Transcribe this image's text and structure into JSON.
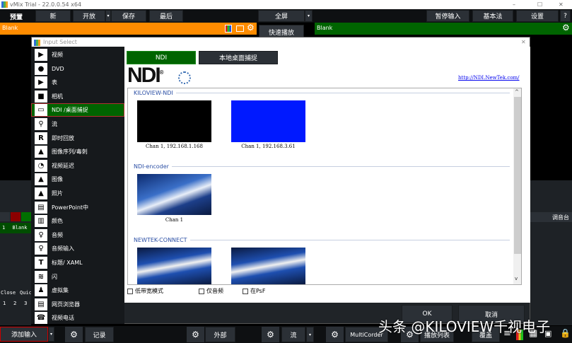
{
  "window": {
    "title": "vMix Trial - 22.0.0.54 x64",
    "min": "–",
    "max": "☐",
    "close": "✕"
  },
  "toolbar": {
    "preset": "预置",
    "new": "新",
    "open": "开放",
    "save": "保存",
    "last": "最后",
    "fullscreen": "全屏",
    "pause_input": "暂停输入",
    "basic": "基本法",
    "settings": "设置",
    "help": "?",
    "dropdown": "▾"
  },
  "preview": {
    "label": "Blank"
  },
  "output": {
    "label": "Blank"
  },
  "quick_play": "快速播放",
  "left_panel": {
    "input_number": "1",
    "input_name": "Blank",
    "close": "Close",
    "quick": "Quic",
    "nums": [
      "1",
      "2",
      "3"
    ]
  },
  "right_panel": {
    "mixer": "调音台"
  },
  "dialog": {
    "title": "Input Select",
    "close": "✕",
    "categories": [
      {
        "label": "视频",
        "icon": "▶"
      },
      {
        "label": "DVD",
        "icon": "●"
      },
      {
        "label": "表",
        "icon": "▶"
      },
      {
        "label": "相机",
        "icon": "■"
      },
      {
        "label": "NDI /桌面捕捉",
        "icon": "▭"
      },
      {
        "label": "流",
        "icon": "⚲"
      },
      {
        "label": "即时回放",
        "icon": "R"
      },
      {
        "label": "图像序列/毒刺",
        "icon": "▲"
      },
      {
        "label": "视频延迟",
        "icon": "◔"
      },
      {
        "label": "图像",
        "icon": "▲"
      },
      {
        "label": "照片",
        "icon": "▲"
      },
      {
        "label": "PowerPoint中",
        "icon": "▤"
      },
      {
        "label": "颜色",
        "icon": "▥"
      },
      {
        "label": "音频",
        "icon": "♀"
      },
      {
        "label": "音频输入",
        "icon": "♀"
      },
      {
        "label": "标题/ XAML",
        "icon": "T"
      },
      {
        "label": "闪",
        "icon": "≋"
      },
      {
        "label": "虚拟集",
        "icon": "♟"
      },
      {
        "label": "网页浏览器",
        "icon": "▤"
      },
      {
        "label": "视频电话",
        "icon": "☎"
      }
    ],
    "selected_index": 4,
    "tabs": [
      "NDI",
      "本地桌面捕捉"
    ],
    "logo": "NDI",
    "link": "http://NDI.NewTek.com/",
    "sections": [
      {
        "name": "KILOVIEW-NDI",
        "sources": [
          {
            "label": "Chan 1, 192.168.1.168",
            "color": "#000000"
          },
          {
            "label": "Chan 1, 192.168.3.61",
            "color": "#0019ff"
          }
        ]
      },
      {
        "name": "NDI-encoder",
        "sources": [
          {
            "label": "Chan 1"
          }
        ]
      },
      {
        "name": "NEWTEK-CONNECT",
        "sources": [
          {
            "label": ""
          },
          {
            "label": ""
          }
        ]
      }
    ],
    "options": [
      "低带宽模式",
      "仅音频",
      "在PsF"
    ],
    "ok": "OK",
    "cancel": "取消"
  },
  "bottom": {
    "add_input": "添加输入",
    "record": "记录",
    "external": "外部",
    "stream": "流",
    "multicorder": "MultiCorder",
    "playlist": "播放列表",
    "overlay": "覆盖"
  },
  "watermark": "头条 @KILOVIEW千视电子"
}
